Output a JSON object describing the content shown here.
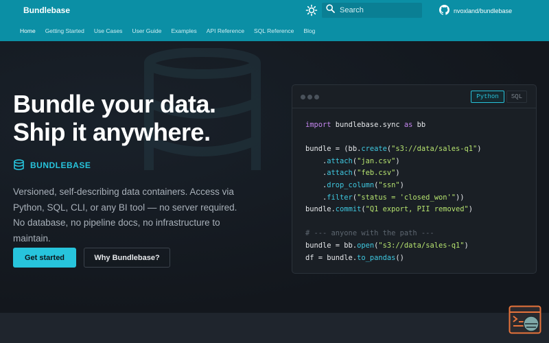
{
  "header": {
    "brand": "Bundlebase",
    "search_placeholder": "Search",
    "repo": "nvoxland/bundlebase",
    "nav": [
      {
        "label": "Home",
        "active": true
      },
      {
        "label": "Getting Started"
      },
      {
        "label": "Use Cases"
      },
      {
        "label": "User Guide"
      },
      {
        "label": "Examples"
      },
      {
        "label": "API Reference"
      },
      {
        "label": "SQL Reference"
      },
      {
        "label": "Blog"
      }
    ]
  },
  "hero": {
    "title_line1": "Bundle your data.",
    "title_line2": "Ship it anywhere.",
    "brand_label": "BUNDLEBASE",
    "description": "Versioned, self-describing data containers. Access via Python, SQL, CLI, or any BI tool — no server required. No database, no pipeline docs, no infrastructure to maintain.",
    "primary_button": "Get started",
    "secondary_button": "Why Bundlebase?"
  },
  "code": {
    "tabs": {
      "python": "Python",
      "sql": "SQL"
    },
    "lines": [
      [
        {
          "t": "import",
          "c": "kw"
        },
        {
          "t": " bundlebase.sync "
        },
        {
          "t": "as",
          "c": "kw"
        },
        {
          "t": " bb"
        }
      ],
      [],
      [
        {
          "t": "bundle = (bb."
        },
        {
          "t": "create",
          "c": "fn"
        },
        {
          "t": "("
        },
        {
          "t": "\"s3://data/sales-q1\"",
          "c": "str"
        },
        {
          "t": ")"
        }
      ],
      [
        {
          "t": "    ."
        },
        {
          "t": "attach",
          "c": "fn"
        },
        {
          "t": "("
        },
        {
          "t": "\"jan.csv\"",
          "c": "str"
        },
        {
          "t": ")"
        }
      ],
      [
        {
          "t": "    ."
        },
        {
          "t": "attach",
          "c": "fn"
        },
        {
          "t": "("
        },
        {
          "t": "\"feb.csv\"",
          "c": "str"
        },
        {
          "t": ")"
        }
      ],
      [
        {
          "t": "    ."
        },
        {
          "t": "drop_column",
          "c": "fn"
        },
        {
          "t": "("
        },
        {
          "t": "\"ssn\"",
          "c": "str"
        },
        {
          "t": ")"
        }
      ],
      [
        {
          "t": "    ."
        },
        {
          "t": "filter",
          "c": "fn"
        },
        {
          "t": "("
        },
        {
          "t": "\"status = 'closed_won'\"",
          "c": "str"
        },
        {
          "t": "))"
        }
      ],
      [
        {
          "t": "bundle."
        },
        {
          "t": "commit",
          "c": "fn"
        },
        {
          "t": "("
        },
        {
          "t": "\"Q1 export, PII removed\"",
          "c": "str"
        },
        {
          "t": ")"
        }
      ],
      [],
      [
        {
          "t": "# --- anyone with the path ---",
          "c": "cm"
        }
      ],
      [
        {
          "t": "bundle = bb."
        },
        {
          "t": "open",
          "c": "fn"
        },
        {
          "t": "("
        },
        {
          "t": "\"s3://data/sales-q1\"",
          "c": "str"
        },
        {
          "t": ")"
        }
      ],
      [
        {
          "t": "df = bundle."
        },
        {
          "t": "to_pandas",
          "c": "fn"
        },
        {
          "t": "()"
        }
      ]
    ]
  },
  "colors": {
    "header": "#0b8fa5",
    "accent": "#27c4dc",
    "background": "#13171d",
    "code_bg": "#1a1f25",
    "helper": "#e8743b"
  },
  "icons": {
    "theme": "sun-icon",
    "search": "search-icon",
    "repo": "github-icon",
    "brand": "database-icon",
    "helper": "chat-helper-icon"
  }
}
